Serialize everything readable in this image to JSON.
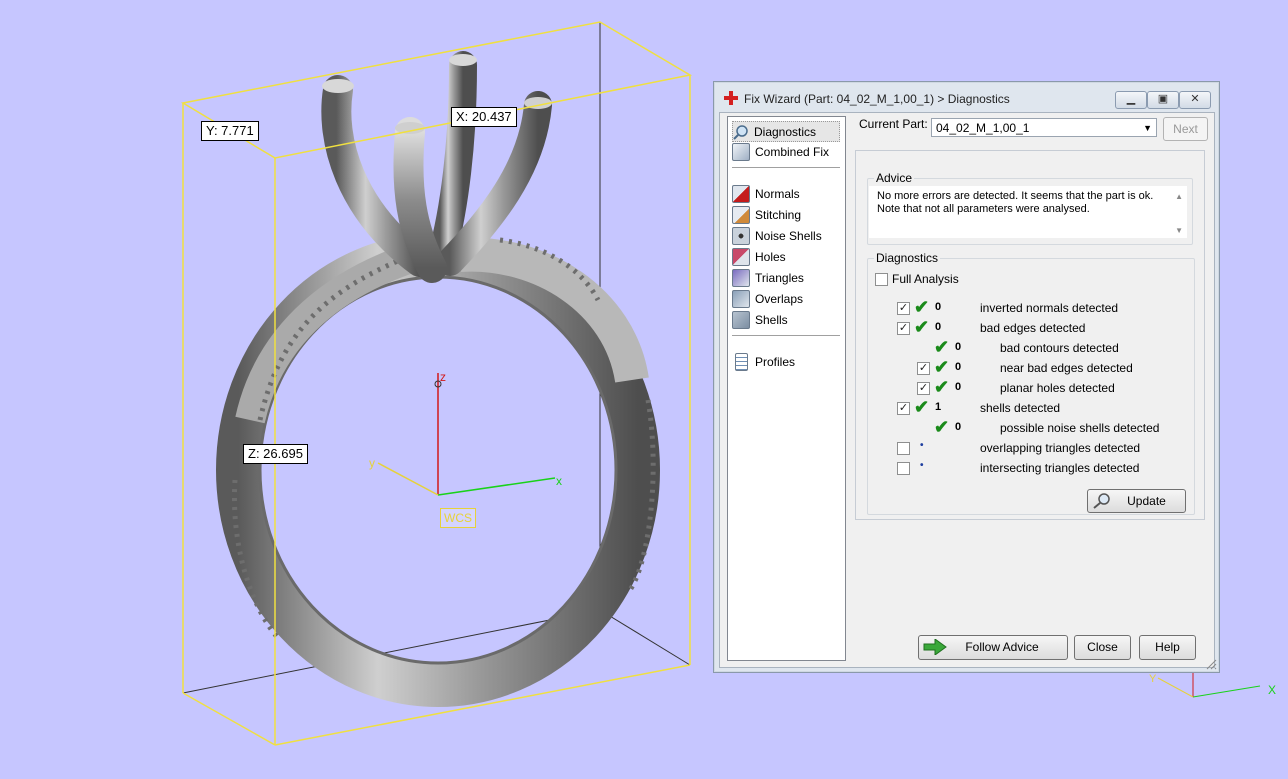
{
  "viewport": {
    "dim_y": "Y: 7.771",
    "dim_x": "X: 20.437",
    "dim_z": "Z: 26.695",
    "axis_z": "z",
    "axis_y": "y",
    "axis_x": "x",
    "wcs": "WCS",
    "mini_x": "X",
    "mini_y": "Y"
  },
  "dialog": {
    "title": "Fix Wizard (Part: 04_02_M_1,00_1) > Diagnostics",
    "nav": [
      {
        "label": "Diagnostics",
        "icon": "magnifier-icon"
      },
      {
        "label": "Combined Fix",
        "icon": "cube-icon"
      },
      {
        "label": "Normals",
        "icon": "normals-icon"
      },
      {
        "label": "Stitching",
        "icon": "stitching-icon"
      },
      {
        "label": "Noise Shells",
        "icon": "noise-shells-icon"
      },
      {
        "label": "Holes",
        "icon": "holes-icon"
      },
      {
        "label": "Triangles",
        "icon": "triangles-icon"
      },
      {
        "label": "Overlaps",
        "icon": "overlaps-icon"
      },
      {
        "label": "Shells",
        "icon": "shells-icon"
      },
      {
        "label": "Profiles",
        "icon": "document-icon"
      }
    ],
    "current_part_label": "Current Part:",
    "current_part_value": "04_02_M_1,00_1",
    "next_label": "Next",
    "advice_title": "Advice",
    "advice_line1": "No more errors are detected. It seems that the part is ok.",
    "advice_line2": "Note that not all parameters were analysed.",
    "diagnostics_title": "Diagnostics",
    "full_analysis_label": "Full Analysis",
    "rows": [
      {
        "checked": true,
        "status": "ok",
        "count": "0",
        "label": "inverted normals detected"
      },
      {
        "checked": true,
        "status": "ok",
        "count": "0",
        "label": "bad edges detected"
      },
      {
        "checked": null,
        "status": "ok",
        "count": "0",
        "label": "bad contours detected"
      },
      {
        "checked": true,
        "status": "ok",
        "count": "0",
        "label": "near bad edges detected"
      },
      {
        "checked": true,
        "status": "ok",
        "count": "0",
        "label": "planar holes detected"
      },
      {
        "checked": true,
        "status": "ok",
        "count": "1",
        "label": "shells detected"
      },
      {
        "checked": null,
        "status": "ok",
        "count": "0",
        "label": "possible noise shells detected"
      },
      {
        "checked": false,
        "status": "none",
        "count": "",
        "label": "overlapping triangles detected"
      },
      {
        "checked": false,
        "status": "none",
        "count": "",
        "label": "intersecting triangles detected"
      }
    ],
    "update_label": "Update",
    "follow_advice_label": "Follow Advice",
    "close_label": "Close",
    "help_label": "Help"
  },
  "colors": {
    "background": "#c6c6ff",
    "bounding_box": "#f0e040",
    "ring": "#8c8c8c",
    "axis_x": "#19d219",
    "axis_y": "#e6d23a",
    "axis_z": "#d21919",
    "check": "#1a8a1a"
  }
}
